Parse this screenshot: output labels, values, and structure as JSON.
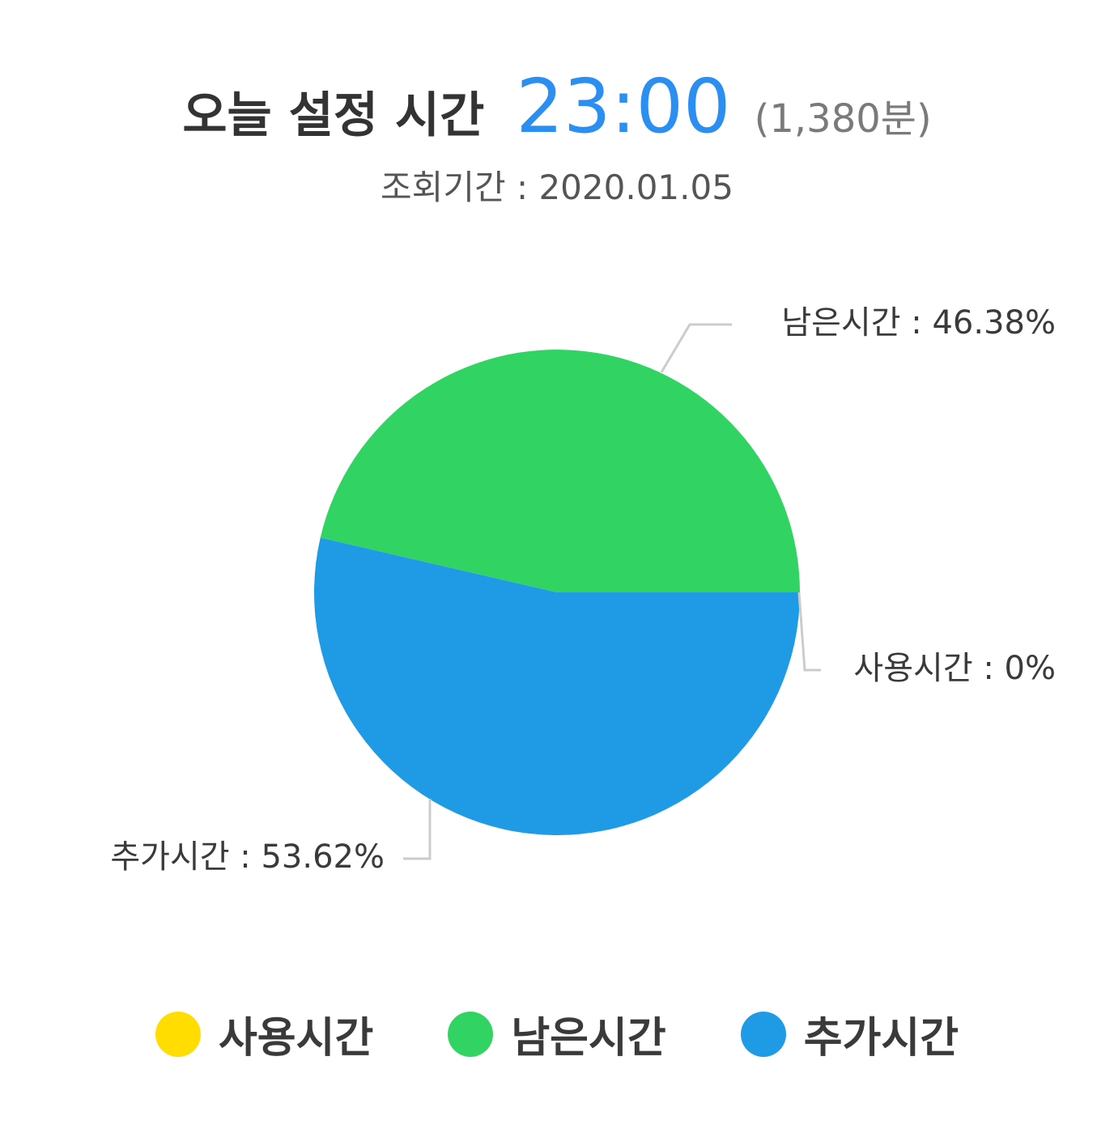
{
  "header": {
    "title": "오늘 설정 시간",
    "time": "23:00",
    "minutes": "(1,380분)"
  },
  "subtitle": "조회기간 : 2020.01.05",
  "chart_data": {
    "type": "pie",
    "slices": [
      {
        "name": "사용시간",
        "value": 0,
        "label": "사용시간 : 0%",
        "color": "#ffdd00"
      },
      {
        "name": "남은시간",
        "value": 46.38,
        "label": "남은시간 : 46.38%",
        "color": "#31d463"
      },
      {
        "name": "추가시간",
        "value": 53.62,
        "label": "추가시간 : 53.62%",
        "color": "#1f9be5"
      }
    ],
    "start_angle_deg": 0,
    "direction": "counterclockwise",
    "legend_position": "bottom"
  },
  "legend": {
    "items": [
      {
        "label": "사용시간",
        "color": "#ffdd00"
      },
      {
        "label": "남은시간",
        "color": "#31d463"
      },
      {
        "label": "추가시간",
        "color": "#1f9be5"
      }
    ]
  }
}
